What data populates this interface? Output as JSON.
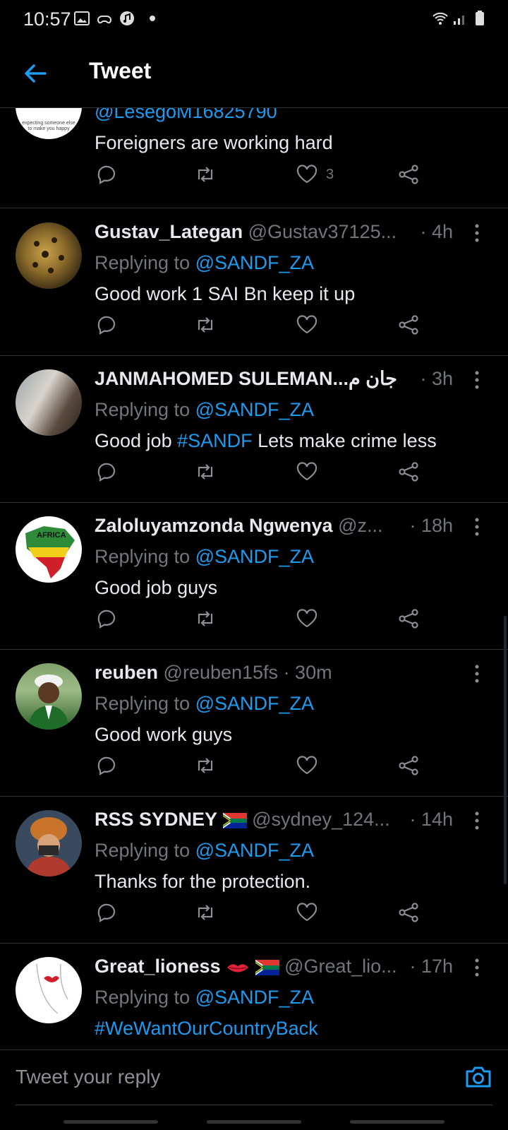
{
  "status_bar": {
    "time": "10:57"
  },
  "header": {
    "title": "Tweet"
  },
  "tweets": [
    {
      "mention_line": "@LesegoM16825790",
      "text": "Foreigners are working hard",
      "like_count": "3",
      "avatar_text": "expecting someone else to make you happy"
    },
    {
      "name": "Gustav_Lategan",
      "handle": "@Gustav37125...",
      "time": "· 4h",
      "replying_prefix": "Replying to ",
      "replying_to": "@SANDF_ZA",
      "text": "Good work 1 SAI Bn keep it up"
    },
    {
      "name": "JANMAHOMED SULEMAN...جان م",
      "handle": "",
      "time": "· 3h",
      "replying_prefix": "Replying to ",
      "replying_to": "@SANDF_ZA",
      "text_before": "Good job ",
      "hashtag": "#SANDF",
      "text_after": " Lets make crime less"
    },
    {
      "name": "Zaloluyamzonda Ngwenya",
      "handle": "@z...",
      "time": "· 18h",
      "replying_prefix": "Replying to ",
      "replying_to": "@SANDF_ZA",
      "text": "Good job guys",
      "avatar_text": "AFRICA"
    },
    {
      "name": "reuben",
      "handle": "@reuben15fs · 30m",
      "time": "",
      "replying_prefix": "Replying to ",
      "replying_to": "@SANDF_ZA",
      "text": "Good work guys"
    },
    {
      "name": "RSS SYDNEY",
      "handle": "@sydney_124...",
      "time": "· 14h",
      "replying_prefix": "Replying to ",
      "replying_to": "@SANDF_ZA",
      "text": "Thanks for the protection."
    },
    {
      "name": "Great_lioness",
      "handle": "@Great_lio...",
      "time": "· 17h",
      "replying_prefix": "Replying to ",
      "replying_to": "@SANDF_ZA",
      "hashtag": "#WeWantOurCountryBack"
    }
  ],
  "composer": {
    "placeholder": "Tweet your reply"
  },
  "colors": {
    "accent": "#1d9bf0",
    "background": "#000000",
    "muted": "#71767b",
    "divider": "#2f3336"
  }
}
